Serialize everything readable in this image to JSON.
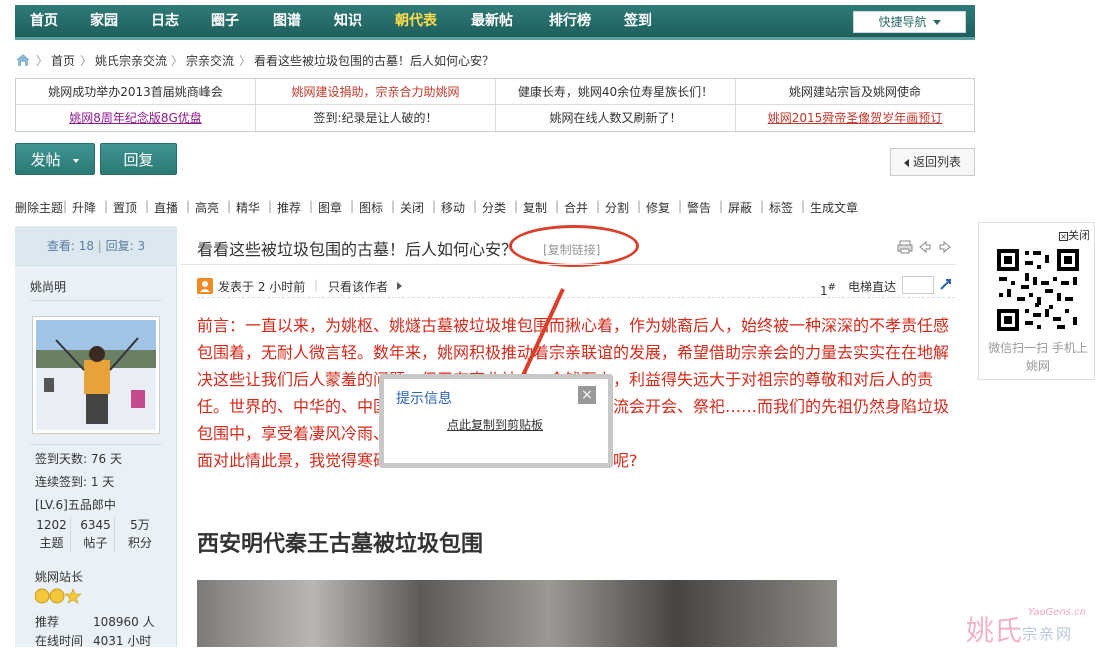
{
  "nav": {
    "items": [
      "首页",
      "家园",
      "日志",
      "圈子",
      "图谱",
      "知识",
      "朝代表",
      "最新帖",
      "排行榜",
      "签到"
    ],
    "active_index": 6,
    "quick_nav": "快捷导航"
  },
  "breadcrumb": {
    "items": [
      "首页",
      "姚氏宗亲交流",
      "宗亲交流",
      "看看这些被垃圾包围的古墓！后人如何心安？"
    ],
    "separator": "〉"
  },
  "notices": {
    "row1": [
      "姚网成功举办2013首届姚商峰会",
      "姚网建设捐助，宗亲合力助姚网",
      "健康长寿，姚网40余位寿星族长们！",
      "姚网建站宗旨及姚网使命"
    ],
    "row2": [
      "姚网8周年纪念版8G优盘",
      "签到:纪录是让人破的！",
      "姚网在线人数又刷新了！",
      "姚网2015舜帝圣像贺岁年画预订"
    ]
  },
  "buttons": {
    "post": "发帖",
    "reply": "回复",
    "back": "返回列表"
  },
  "mod_tools": [
    "删除主题",
    "升降",
    "置顶",
    "直播",
    "高亮",
    "精华",
    "推荐",
    "图章",
    "图标",
    "关闭",
    "移动",
    "分类",
    "复制",
    "合并",
    "分割",
    "修复",
    "警告",
    "屏蔽",
    "标签",
    "生成文章"
  ],
  "sidebar": {
    "views_label": "查看:",
    "views": "18",
    "replies_label": "回复:",
    "replies": "3",
    "username": "姚尚明",
    "signin_days": "签到天数: 76 天",
    "streak": "连续签到: 1 天",
    "level": "[LV.6]五品郎中",
    "counts": [
      {
        "value": "1202",
        "label": "主题"
      },
      {
        "value": "6345",
        "label": "帖子"
      },
      {
        "value": "5万",
        "label": "积分"
      }
    ],
    "role": "姚网站长",
    "recommend_label": "推荐",
    "recommend_value": "108960 人",
    "online_label": "在线时间",
    "online_value": "4031 小时"
  },
  "post": {
    "title": "看看这些被垃圾包围的古墓！后人如何心安？",
    "copy_link": "[复制链接]",
    "posted": "发表于 2 小时前",
    "author_only": "只看该作者",
    "floor": "1",
    "floor_suffix": "#",
    "elevator": "电梯直达",
    "paragraph": "前言：一直以来，为姚枢、姚燧古墓被垃圾堆包围而揪心着，作为姚裔后人，始终被一种深深的不孝责任感包围着，无耐人微言轻。数年来，姚网积极推动着宗亲联谊的发展，希望借助宗亲会的力量去实实在在地解决这些让我们后人蒙羞的问题。但无奈商业社会，金钱至上，利益得失远大于对祖宗的尊敬和对后人的责任。世界的、中华的、中国的、各地的宗亲会、联谊会、交流会开会、祭祀……而我们的先祖仍然身陷垃圾包围中，享受着凄风冷雨、阵阵车轮和熏天恶臭.....",
    "line2": "面对此情此景，我觉得寒碜、我觉得羞耻、我觉得揪心，你呢?",
    "subheading": "西安明代秦王古墓被垃圾包围"
  },
  "dialog": {
    "title": "提示信息",
    "link": "点此复制到剪贴板",
    "close": "×"
  },
  "qr": {
    "close": "关闭",
    "caption": "微信扫一扫 手机上姚网"
  },
  "watermark": {
    "main": "姚氏",
    "sub": "宗亲网",
    "url": "YaoGens.cn"
  },
  "colors": {
    "nav_bg": "#2a706c",
    "nav_active": "#ffde4a",
    "accent_red": "#d32a1a",
    "annotation": "#d9402b",
    "link_red": "#c0392b",
    "link_purple": "#8b1a8b"
  }
}
